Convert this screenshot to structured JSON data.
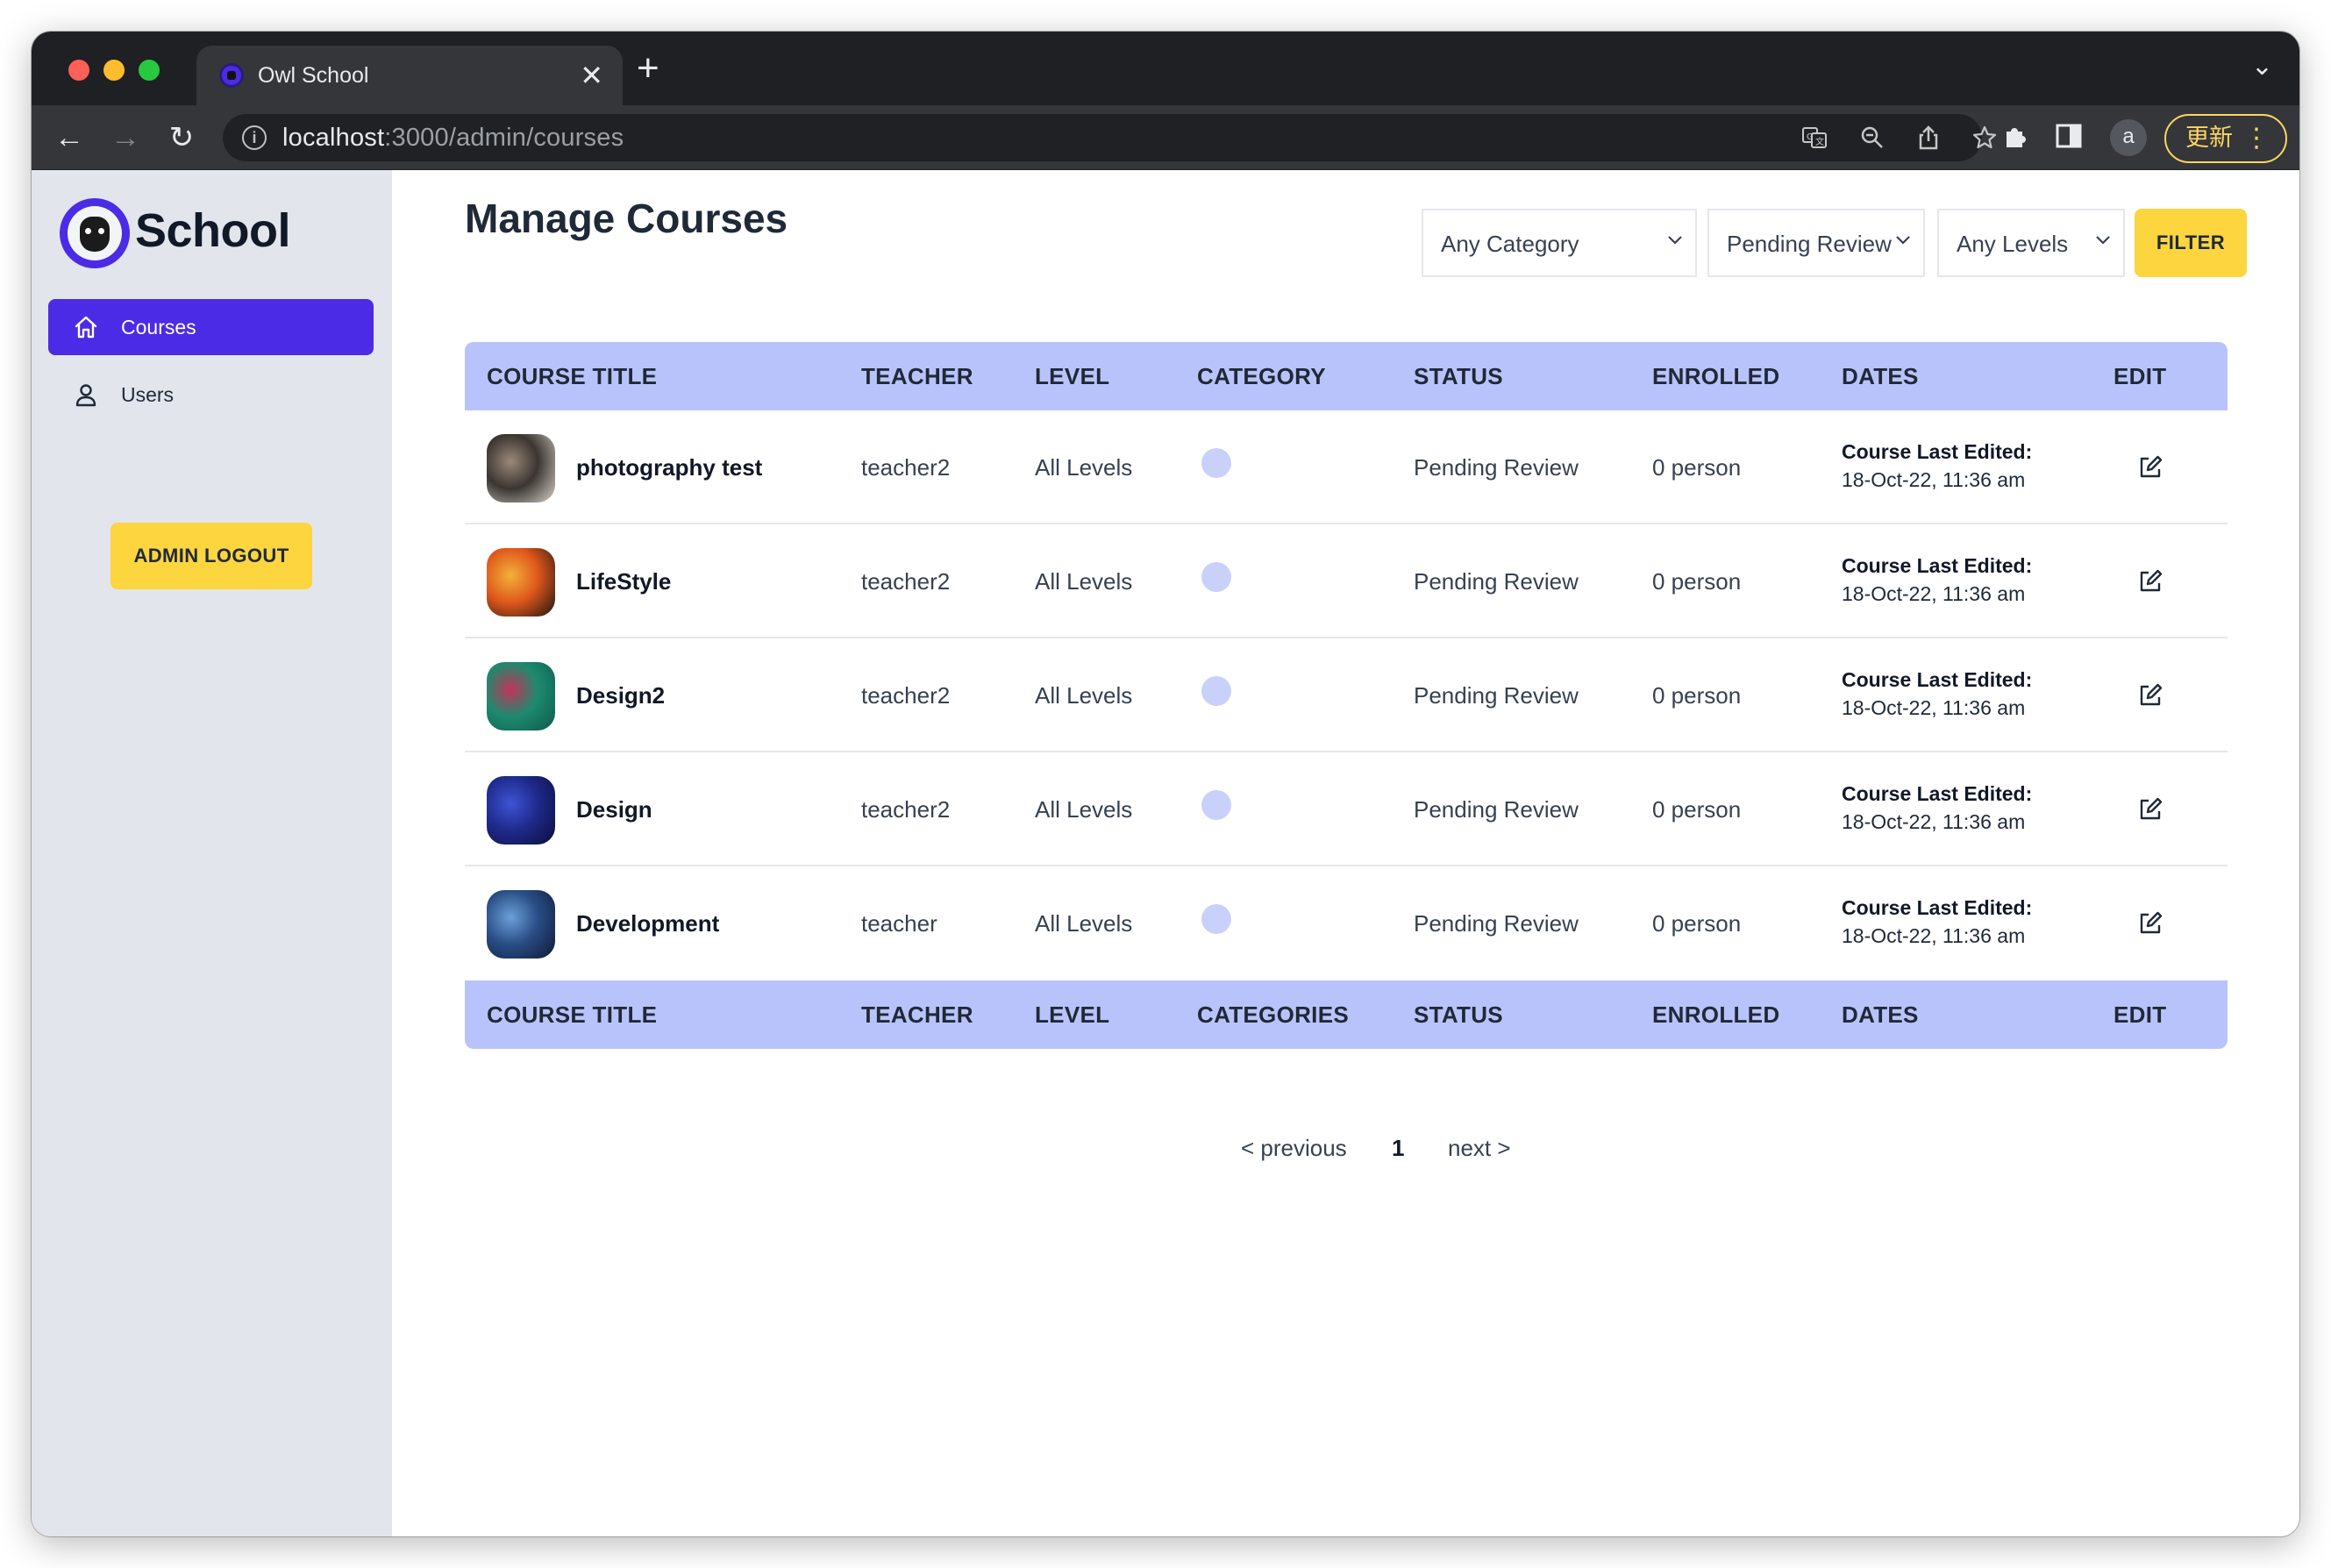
{
  "browser": {
    "tab_title": "Owl School",
    "url_host": "localhost",
    "url_path": ":3000/admin/courses",
    "profile_initial": "a",
    "update_label": "更新"
  },
  "sidebar": {
    "logo_text": "School",
    "items": [
      {
        "label": "Courses",
        "icon": "home-icon",
        "active": true
      },
      {
        "label": "Users",
        "icon": "user-icon",
        "active": false
      }
    ],
    "logout_label": "ADMIN LOGOUT"
  },
  "main": {
    "title": "Manage Courses",
    "filters": {
      "category": "Any Category",
      "status": "Pending Review",
      "level": "Any Levels",
      "button_label": "FILTER"
    }
  },
  "table": {
    "header": [
      "COURSE TITLE",
      "TEACHER",
      "LEVEL",
      "CATEGORY",
      "STATUS",
      "ENROLLED",
      "DATES",
      "EDIT"
    ],
    "footer": [
      "COURSE TITLE",
      "TEACHER",
      "LEVEL",
      "CATEGORIES",
      "STATUS",
      "ENROLLED",
      "DATES",
      "EDIT"
    ],
    "rows": [
      {
        "title": "photography test",
        "teacher": "teacher2",
        "level": "All Levels",
        "status": "Pending Review",
        "enrolled": "0 person",
        "date_label": "Course Last Edited:",
        "date": "18-Oct-22, 11:36 am",
        "thumb_colors": [
          "#d8d2c9",
          "#3b3532",
          "#9b8a78"
        ]
      },
      {
        "title": "LifeStyle",
        "teacher": "teacher2",
        "level": "All Levels",
        "status": "Pending Review",
        "enrolled": "0 person",
        "date_label": "Course Last Edited:",
        "date": "18-Oct-22, 11:36 am",
        "thumb_colors": [
          "#1a1410",
          "#e0581c",
          "#f1b23a"
        ]
      },
      {
        "title": "Design2",
        "teacher": "teacher2",
        "level": "All Levels",
        "status": "Pending Review",
        "enrolled": "0 person",
        "date_label": "Course Last Edited:",
        "date": "18-Oct-22, 11:36 am",
        "thumb_colors": [
          "#0e5a4a",
          "#1d8a6f",
          "#c2345a"
        ]
      },
      {
        "title": "Design",
        "teacher": "teacher2",
        "level": "All Levels",
        "status": "Pending Review",
        "enrolled": "0 person",
        "date_label": "Course Last Edited:",
        "date": "18-Oct-22, 11:36 am",
        "thumb_colors": [
          "#0b0e3a",
          "#1f2a8c",
          "#3e54d6"
        ]
      },
      {
        "title": "Development",
        "teacher": "teacher",
        "level": "All Levels",
        "status": "Pending Review",
        "enrolled": "0 person",
        "date_label": "Course Last Edited:",
        "date": "18-Oct-22, 11:36 am",
        "thumb_colors": [
          "#0d1a33",
          "#2a4d86",
          "#6aa0d8"
        ]
      }
    ]
  },
  "pagination": {
    "previous": "< previous",
    "page": "1",
    "next": "next >"
  }
}
